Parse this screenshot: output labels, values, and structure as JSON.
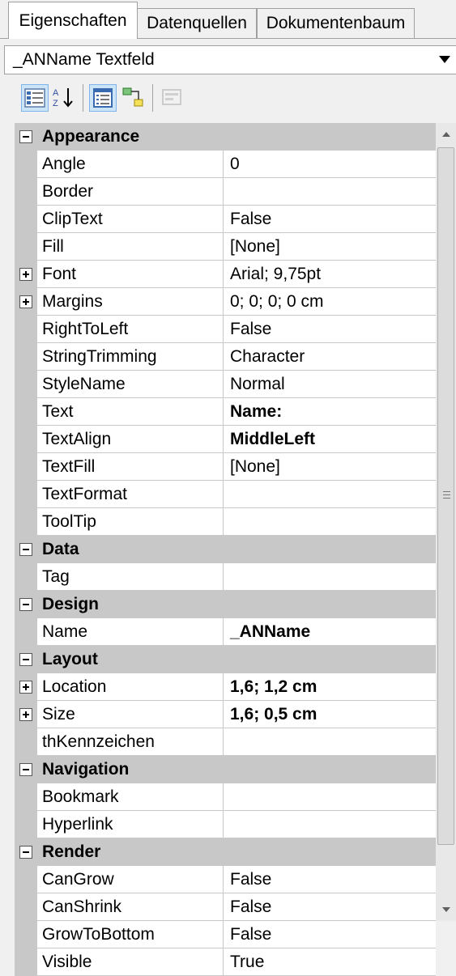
{
  "tabs": [
    {
      "label": "Eigenschaften",
      "active": true
    },
    {
      "label": "Datenquellen",
      "active": false
    },
    {
      "label": "Dokumentenbaum",
      "active": false
    }
  ],
  "object_selector": {
    "value": "_ANName Textfeld"
  },
  "toolbar": {
    "buttons": [
      {
        "icon": "categorized-icon",
        "pressed": true
      },
      {
        "icon": "sort-alphabetical-icon",
        "pressed": false
      },
      {
        "icon": "properties-icon",
        "pressed": true
      },
      {
        "icon": "events-icon",
        "pressed": false
      },
      {
        "icon": "property-pages-icon",
        "pressed": false,
        "disabled": true
      }
    ]
  },
  "categories": [
    {
      "name": "Appearance",
      "properties": [
        {
          "name": "Angle",
          "value": "0"
        },
        {
          "name": "Border",
          "value": ""
        },
        {
          "name": "ClipText",
          "value": "False"
        },
        {
          "name": "Fill",
          "value": "[None]"
        },
        {
          "name": "Font",
          "value": "Arial; 9,75pt",
          "expandable": true
        },
        {
          "name": "Margins",
          "value": "0; 0; 0; 0 cm",
          "expandable": true
        },
        {
          "name": "RightToLeft",
          "value": "False"
        },
        {
          "name": "StringTrimming",
          "value": "Character"
        },
        {
          "name": "StyleName",
          "value": "Normal"
        },
        {
          "name": "Text",
          "value": "Name:",
          "bold": true
        },
        {
          "name": "TextAlign",
          "value": "MiddleLeft",
          "bold": true
        },
        {
          "name": "TextFill",
          "value": "[None]"
        },
        {
          "name": "TextFormat",
          "value": ""
        },
        {
          "name": "ToolTip",
          "value": ""
        }
      ]
    },
    {
      "name": "Data",
      "properties": [
        {
          "name": "Tag",
          "value": ""
        }
      ]
    },
    {
      "name": "Design",
      "properties": [
        {
          "name": "Name",
          "value": "_ANName",
          "bold": true
        }
      ]
    },
    {
      "name": "Layout",
      "properties": [
        {
          "name": "Location",
          "value": "1,6; 1,2 cm",
          "bold": true,
          "expandable": true
        },
        {
          "name": "Size",
          "value": "1,6; 0,5 cm",
          "bold": true,
          "expandable": true
        },
        {
          "name": "thKennzeichen",
          "value": ""
        }
      ]
    },
    {
      "name": "Navigation",
      "properties": [
        {
          "name": "Bookmark",
          "value": ""
        },
        {
          "name": "Hyperlink",
          "value": ""
        }
      ]
    },
    {
      "name": "Render",
      "properties": [
        {
          "name": "CanGrow",
          "value": "False"
        },
        {
          "name": "CanShrink",
          "value": "False"
        },
        {
          "name": "GrowToBottom",
          "value": "False"
        },
        {
          "name": "Visible",
          "value": "True"
        }
      ]
    }
  ]
}
